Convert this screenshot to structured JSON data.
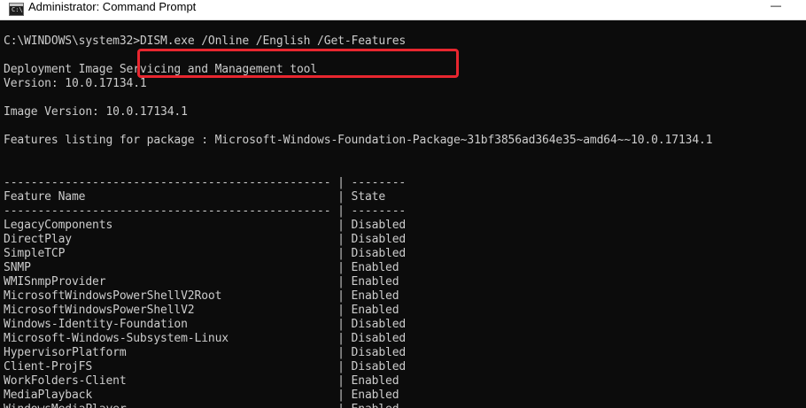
{
  "window": {
    "title": "Administrator: Command Prompt",
    "icon": "cmd-icon",
    "icon_glyph": "C:\\",
    "minimize_glyph": "—"
  },
  "console": {
    "prompt": "C:\\WINDOWS\\system32>",
    "command": "DISM.exe /Online /English /Get-Features",
    "tool_name": "Deployment Image Servicing and Management tool",
    "version": "Version: 10.0.17134.1",
    "image_version": "Image Version: 10.0.17134.1",
    "features_listing": "Features listing for package : Microsoft-Windows-Foundation-Package~31bf3856ad364e35~amd64~~10.0.17134.1",
    "separator": "------------------------------------------------ | --------",
    "header_feature": "Feature Name",
    "header_state": "State",
    "features": [
      {
        "name": "LegacyComponents",
        "state": "Disabled"
      },
      {
        "name": "DirectPlay",
        "state": "Disabled"
      },
      {
        "name": "SimpleTCP",
        "state": "Disabled"
      },
      {
        "name": "SNMP",
        "state": "Enabled"
      },
      {
        "name": "WMISnmpProvider",
        "state": "Enabled"
      },
      {
        "name": "MicrosoftWindowsPowerShellV2Root",
        "state": "Enabled"
      },
      {
        "name": "MicrosoftWindowsPowerShellV2",
        "state": "Enabled"
      },
      {
        "name": "Windows-Identity-Foundation",
        "state": "Disabled"
      },
      {
        "name": "Microsoft-Windows-Subsystem-Linux",
        "state": "Disabled"
      },
      {
        "name": "HypervisorPlatform",
        "state": "Disabled"
      },
      {
        "name": "Client-ProjFS",
        "state": "Disabled"
      },
      {
        "name": "WorkFolders-Client",
        "state": "Enabled"
      },
      {
        "name": "MediaPlayback",
        "state": "Enabled"
      },
      {
        "name": "WindowsMediaPlayer",
        "state": "Enabled"
      }
    ],
    "highlight_color": "#e8262f",
    "text_color": "#cccccc",
    "background_color": "#0c0c0c"
  }
}
